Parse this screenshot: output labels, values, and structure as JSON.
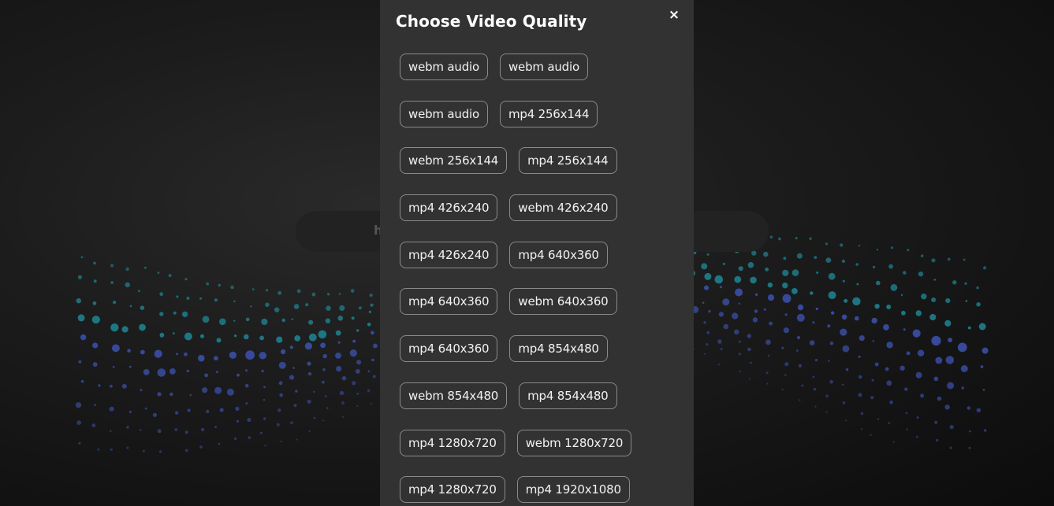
{
  "background": {
    "search_hint": "h"
  },
  "modal": {
    "title": "Choose Video Quality",
    "close_label": "×",
    "options": [
      [
        "webm audio",
        "webm audio"
      ],
      [
        "webm audio",
        "mp4 256x144"
      ],
      [
        "webm 256x144",
        "mp4 256x144"
      ],
      [
        "mp4 426x240",
        "webm 426x240"
      ],
      [
        "mp4 426x240",
        "mp4 640x360"
      ],
      [
        "mp4 640x360",
        "webm 640x360"
      ],
      [
        "mp4 640x360",
        "mp4 854x480"
      ],
      [
        "webm 854x480",
        "mp4 854x480"
      ],
      [
        "mp4 1280x720",
        "webm 1280x720"
      ],
      [
        "mp4 1280x720",
        "mp4 1920x1080"
      ]
    ]
  },
  "colors": {
    "modal_bg": "#323232",
    "button_border": "#8a8a8a",
    "dot_teal": "#1f8a9a",
    "dot_blue": "#3a4fa8"
  }
}
